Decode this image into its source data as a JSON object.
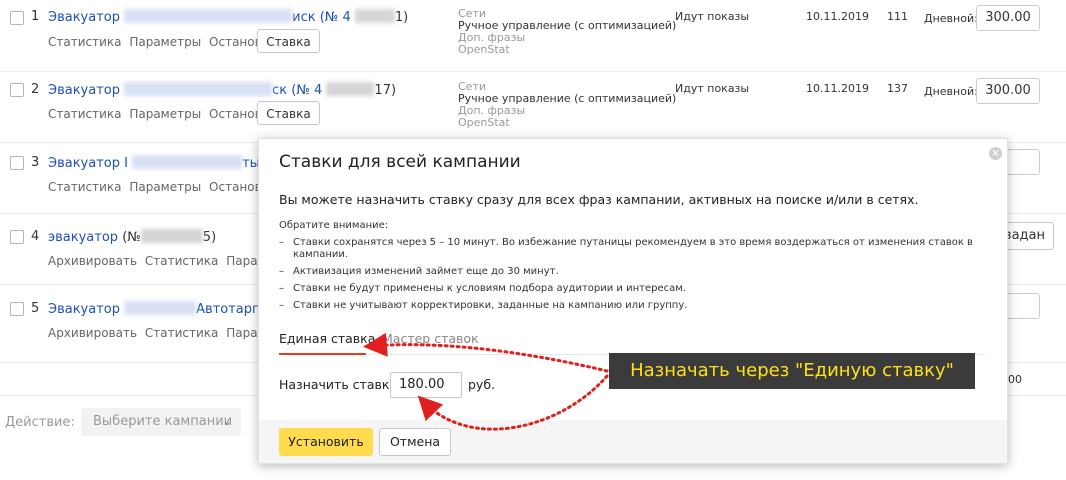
{
  "rows": [
    {
      "num": "1",
      "name": "Эвакуатор",
      "name_tail": "иск (№ 4",
      "name_end": "1)",
      "links": [
        "Статистика",
        "Параметры",
        "Остановить"
      ],
      "bid_button": "Ставка",
      "meta": [
        "Сети",
        "Ручное управление (с оптимизацией)",
        "Доп. фразы",
        "OpenStat"
      ],
      "status": "Идут показы",
      "date": "10.11.2019",
      "count": "111",
      "budget_label": "Дневной:",
      "budget": "300.00"
    },
    {
      "num": "2",
      "name": "Эвакуатор",
      "name_tail": "ск (№ 4",
      "name_end": "17)",
      "links": [
        "Статистика",
        "Параметры",
        "Остановить"
      ],
      "bid_button": "Ставка",
      "meta": [
        "Сети",
        "Ручное управление (с оптимизацией)",
        "Доп. фразы",
        "OpenStat"
      ],
      "status": "Идут показы",
      "date": "10.11.2019",
      "count": "137",
      "budget_label": "Дневной:",
      "budget": "300.00"
    },
    {
      "num": "3",
      "name": "Эвакуатор I",
      "name_tail": "ты –",
      "links": [
        "Статистика",
        "Параметры",
        "Остановить"
      ]
    },
    {
      "num": "4",
      "name": "эвакуатор",
      "name_tail": "(№",
      "name_end": "5)",
      "links": [
        "Архивировать",
        "Статистика",
        "Параметр"
      ],
      "right_button": "задан"
    },
    {
      "num": "5",
      "name": "Эвакуатор",
      "name_tail": "Автотарг",
      "links": [
        "Архивировать",
        "Статистика",
        "Параметр"
      ]
    }
  ],
  "right_fragment": "00",
  "footer": {
    "action_label": "Действие:",
    "select_placeholder": "Выберите кампании"
  },
  "popup": {
    "title": "Ставки для всей кампании",
    "lead": "Вы можете назначить ставку сразу для всех фраз кампании, активных на поиске и/или в сетях.",
    "notice": "Обратите внимание:",
    "bullets": [
      "Ставки сохранятся через 5 – 10 минут. Во избежание путаницы рекомендуем в это время воздержаться от изменения ставок в кампании.",
      "Активизация изменений займет еще до 30 минут.",
      "Ставки не будут применены к условиям подбора аудитории и интересам.",
      "Ставки не учитывают корректировки, заданные на кампанию или группу."
    ],
    "tab_active": "Единая ставка",
    "tab_inactive": "Мастер ставок",
    "bid_label": "Назначить ставку",
    "bid_value": "180.00",
    "bid_unit": "руб.",
    "set_button": "Установить",
    "cancel_button": "Отмена"
  },
  "callout": "Назначать через \"Единую ставку\"",
  "colors": {
    "link": "#1f4fb8",
    "accent_yellow": "#ffdb4d",
    "tab_accent": "#e8391e",
    "annotation_red": "#e02020",
    "callout_bg": "#3b3b3b",
    "callout_text": "#ffe01b"
  }
}
